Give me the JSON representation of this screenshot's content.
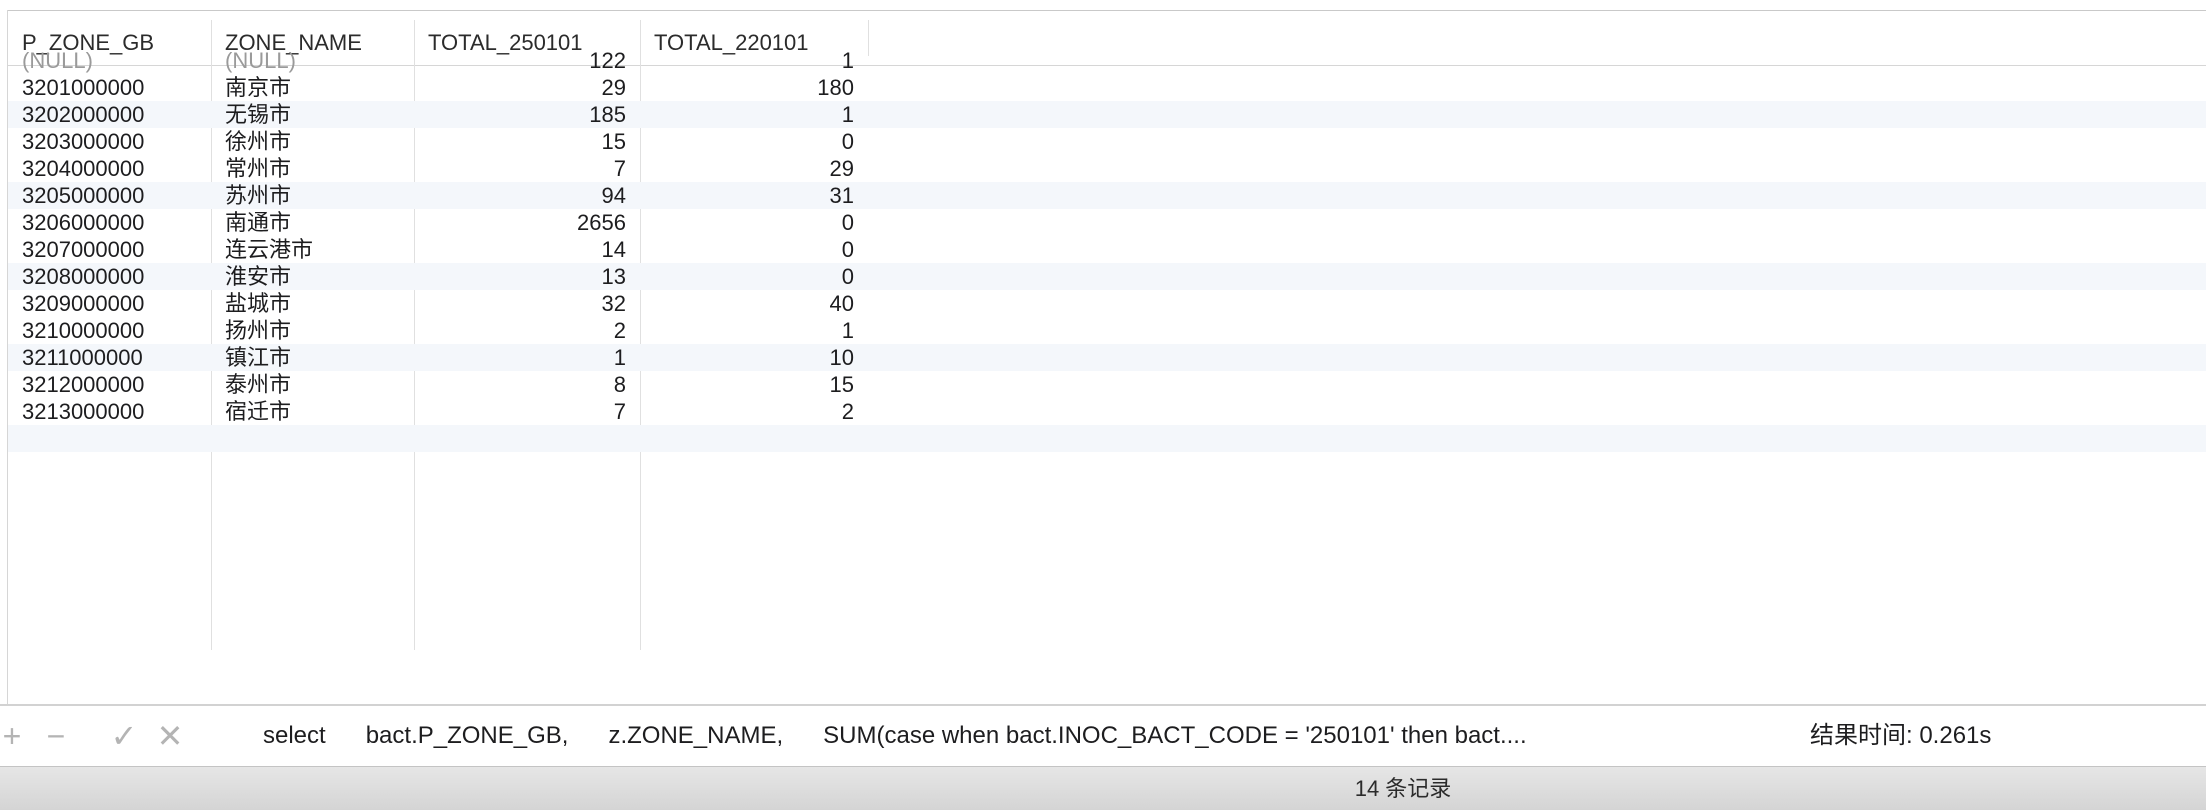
{
  "table": {
    "columns": [
      "P_ZONE_GB",
      "ZONE_NAME",
      "TOTAL_250101",
      "TOTAL_220101"
    ],
    "rows": [
      {
        "p_zone_gb": "(NULL)",
        "zone_name": "(NULL)",
        "total_250101": "122",
        "total_220101": "1"
      },
      {
        "p_zone_gb": "3201000000",
        "zone_name": "南京市",
        "total_250101": "29",
        "total_220101": "180"
      },
      {
        "p_zone_gb": "3202000000",
        "zone_name": "无锡市",
        "total_250101": "185",
        "total_220101": "1"
      },
      {
        "p_zone_gb": "3203000000",
        "zone_name": "徐州市",
        "total_250101": "15",
        "total_220101": "0"
      },
      {
        "p_zone_gb": "3204000000",
        "zone_name": "常州市",
        "total_250101": "7",
        "total_220101": "29"
      },
      {
        "p_zone_gb": "3205000000",
        "zone_name": "苏州市",
        "total_250101": "94",
        "total_220101": "31"
      },
      {
        "p_zone_gb": "3206000000",
        "zone_name": "南通市",
        "total_250101": "2656",
        "total_220101": "0"
      },
      {
        "p_zone_gb": "3207000000",
        "zone_name": "连云港市",
        "total_250101": "14",
        "total_220101": "0"
      },
      {
        "p_zone_gb": "3208000000",
        "zone_name": "淮安市",
        "total_250101": "13",
        "total_220101": "0"
      },
      {
        "p_zone_gb": "3209000000",
        "zone_name": "盐城市",
        "total_250101": "32",
        "total_220101": "40"
      },
      {
        "p_zone_gb": "3210000000",
        "zone_name": "扬州市",
        "total_250101": "2",
        "total_220101": "1"
      },
      {
        "p_zone_gb": "3211000000",
        "zone_name": "镇江市",
        "total_250101": "1",
        "total_220101": "10"
      },
      {
        "p_zone_gb": "3212000000",
        "zone_name": "泰州市",
        "total_250101": "8",
        "total_220101": "15"
      },
      {
        "p_zone_gb": "3213000000",
        "zone_name": "宿迁市",
        "total_250101": "7",
        "total_220101": "2"
      }
    ]
  },
  "status": {
    "add_symbol": "+",
    "remove_symbol": "−",
    "confirm_symbol": "✓",
    "cancel_symbol": "✕",
    "sql_preview": "select      bact.P_ZONE_GB,      z.ZONE_NAME,      SUM(case when bact.INOC_BACT_CODE = '250101' then bact....",
    "result_time": "结果时间: 0.261s"
  },
  "footer": {
    "record_count": "14 条记录"
  }
}
